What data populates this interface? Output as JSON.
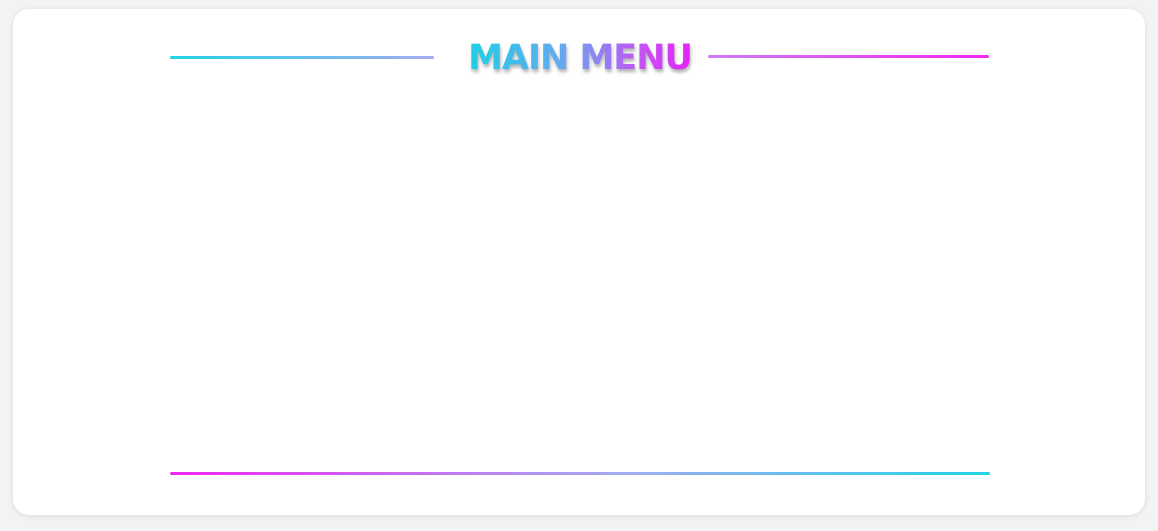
{
  "menu": {
    "title": "MAIN MENU",
    "items": []
  },
  "colors": {
    "accent_cyan": "#22d3e6",
    "accent_magenta": "#f026f2",
    "panel_background": "#ffffff",
    "page_background": "#f3f3f3"
  }
}
